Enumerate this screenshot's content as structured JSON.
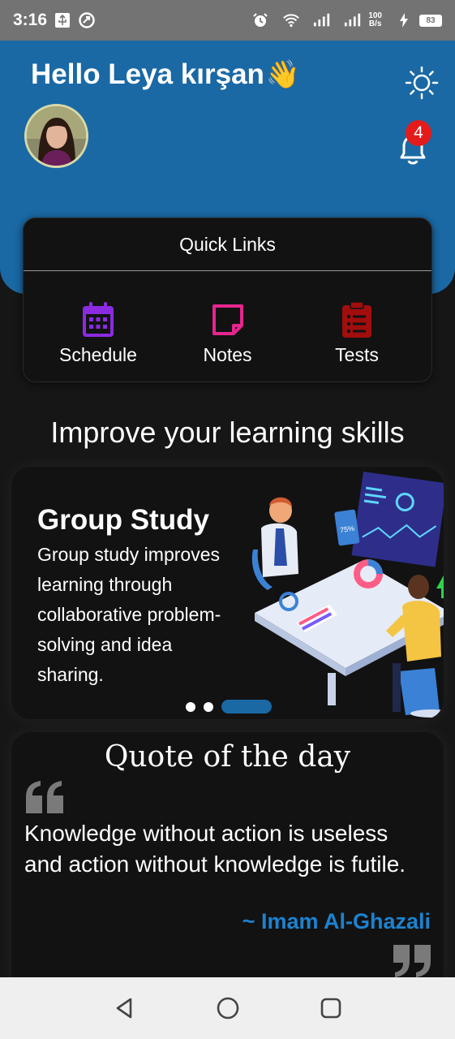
{
  "status_bar": {
    "time": "3:16",
    "network_speed_value": "100",
    "network_speed_unit": "B/s",
    "battery": "83"
  },
  "header": {
    "greeting": "Hello Leya kırşan",
    "greeting_emoji": "👋",
    "notification_count": "4"
  },
  "quick_links": {
    "title": "Quick Links",
    "items": [
      {
        "label": "Schedule",
        "icon": "calendar-icon",
        "color": "#8a2be2"
      },
      {
        "label": "Notes",
        "icon": "sticky-note-icon",
        "color": "#e6258f"
      },
      {
        "label": "Tests",
        "icon": "clipboard-list-icon",
        "color": "#a20d0d"
      }
    ]
  },
  "section": {
    "title": "Improve your learning skills"
  },
  "carousel": {
    "card_title": "Group Study",
    "card_description": "Group study improves learning through collaborative problem-solving and idea sharing.",
    "illustration_label": "75%",
    "active_index": 2,
    "slide_count": 3
  },
  "quote": {
    "heading": "Quote of the day",
    "text": "Knowledge without action is useless and action without knowledge is futile.",
    "author": "~ Imam Al-Ghazali"
  },
  "colors": {
    "primary": "#1a69a5",
    "background": "#161616",
    "card": "#121212",
    "author": "#1d82cf",
    "badge": "#e41b1b"
  }
}
